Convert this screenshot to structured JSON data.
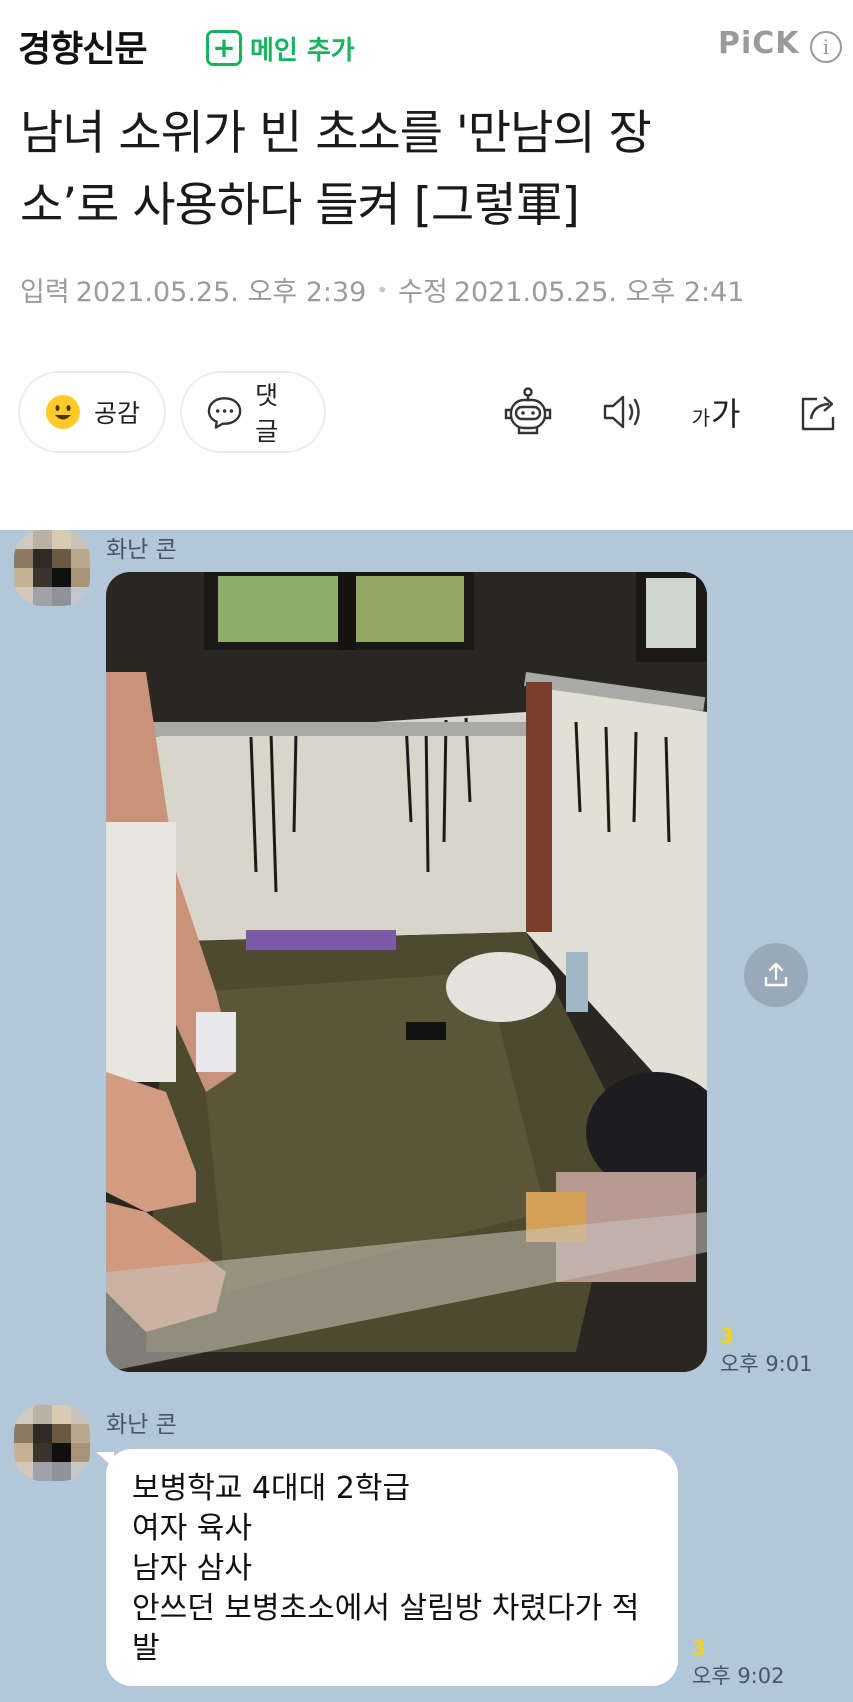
{
  "header": {
    "press_name": "경향신문",
    "subscribe_plus": "+",
    "subscribe_label": "메인 추가",
    "pick_label": "PiCK",
    "info_glyph": "i"
  },
  "article": {
    "headline_line1": "남녀 소위가 빈 초소를 '만남의 장",
    "headline_line2": "소’로 사용하다 들켜 [그렇軍]",
    "input_label": "입력",
    "input_datetime": "2021.05.25. 오후 2:39",
    "separator": "•",
    "edit_label": "수정",
    "edit_datetime": "2021.05.25. 오후 2:41"
  },
  "actions": {
    "react_label": "공감",
    "comment_label": "댓글",
    "font_small": "가",
    "font_large": "가",
    "icons": [
      "smile-icon",
      "chat-bubble-icon",
      "robot-summary-icon",
      "speaker-icon",
      "font-size-icon",
      "share-icon"
    ]
  },
  "chat": {
    "background": "#b2c7d9",
    "messages": [
      {
        "sender": "화난 콘",
        "type": "photo",
        "unread": "3",
        "time": "오후 9:01"
      },
      {
        "sender": "화난 콘",
        "type": "text",
        "lines": [
          "보병학교 4대대 2학급",
          "여자 육사",
          "남자 삼사",
          "안쓰던 보병초소에서 살림방 차렸다가 적",
          "발"
        ],
        "unread": "3",
        "time": "오후 9:02"
      }
    ]
  },
  "colors": {
    "brand_green": "#17b35f",
    "unread_yellow": "#f5d21f",
    "meta_gray": "#9b9b9b"
  }
}
